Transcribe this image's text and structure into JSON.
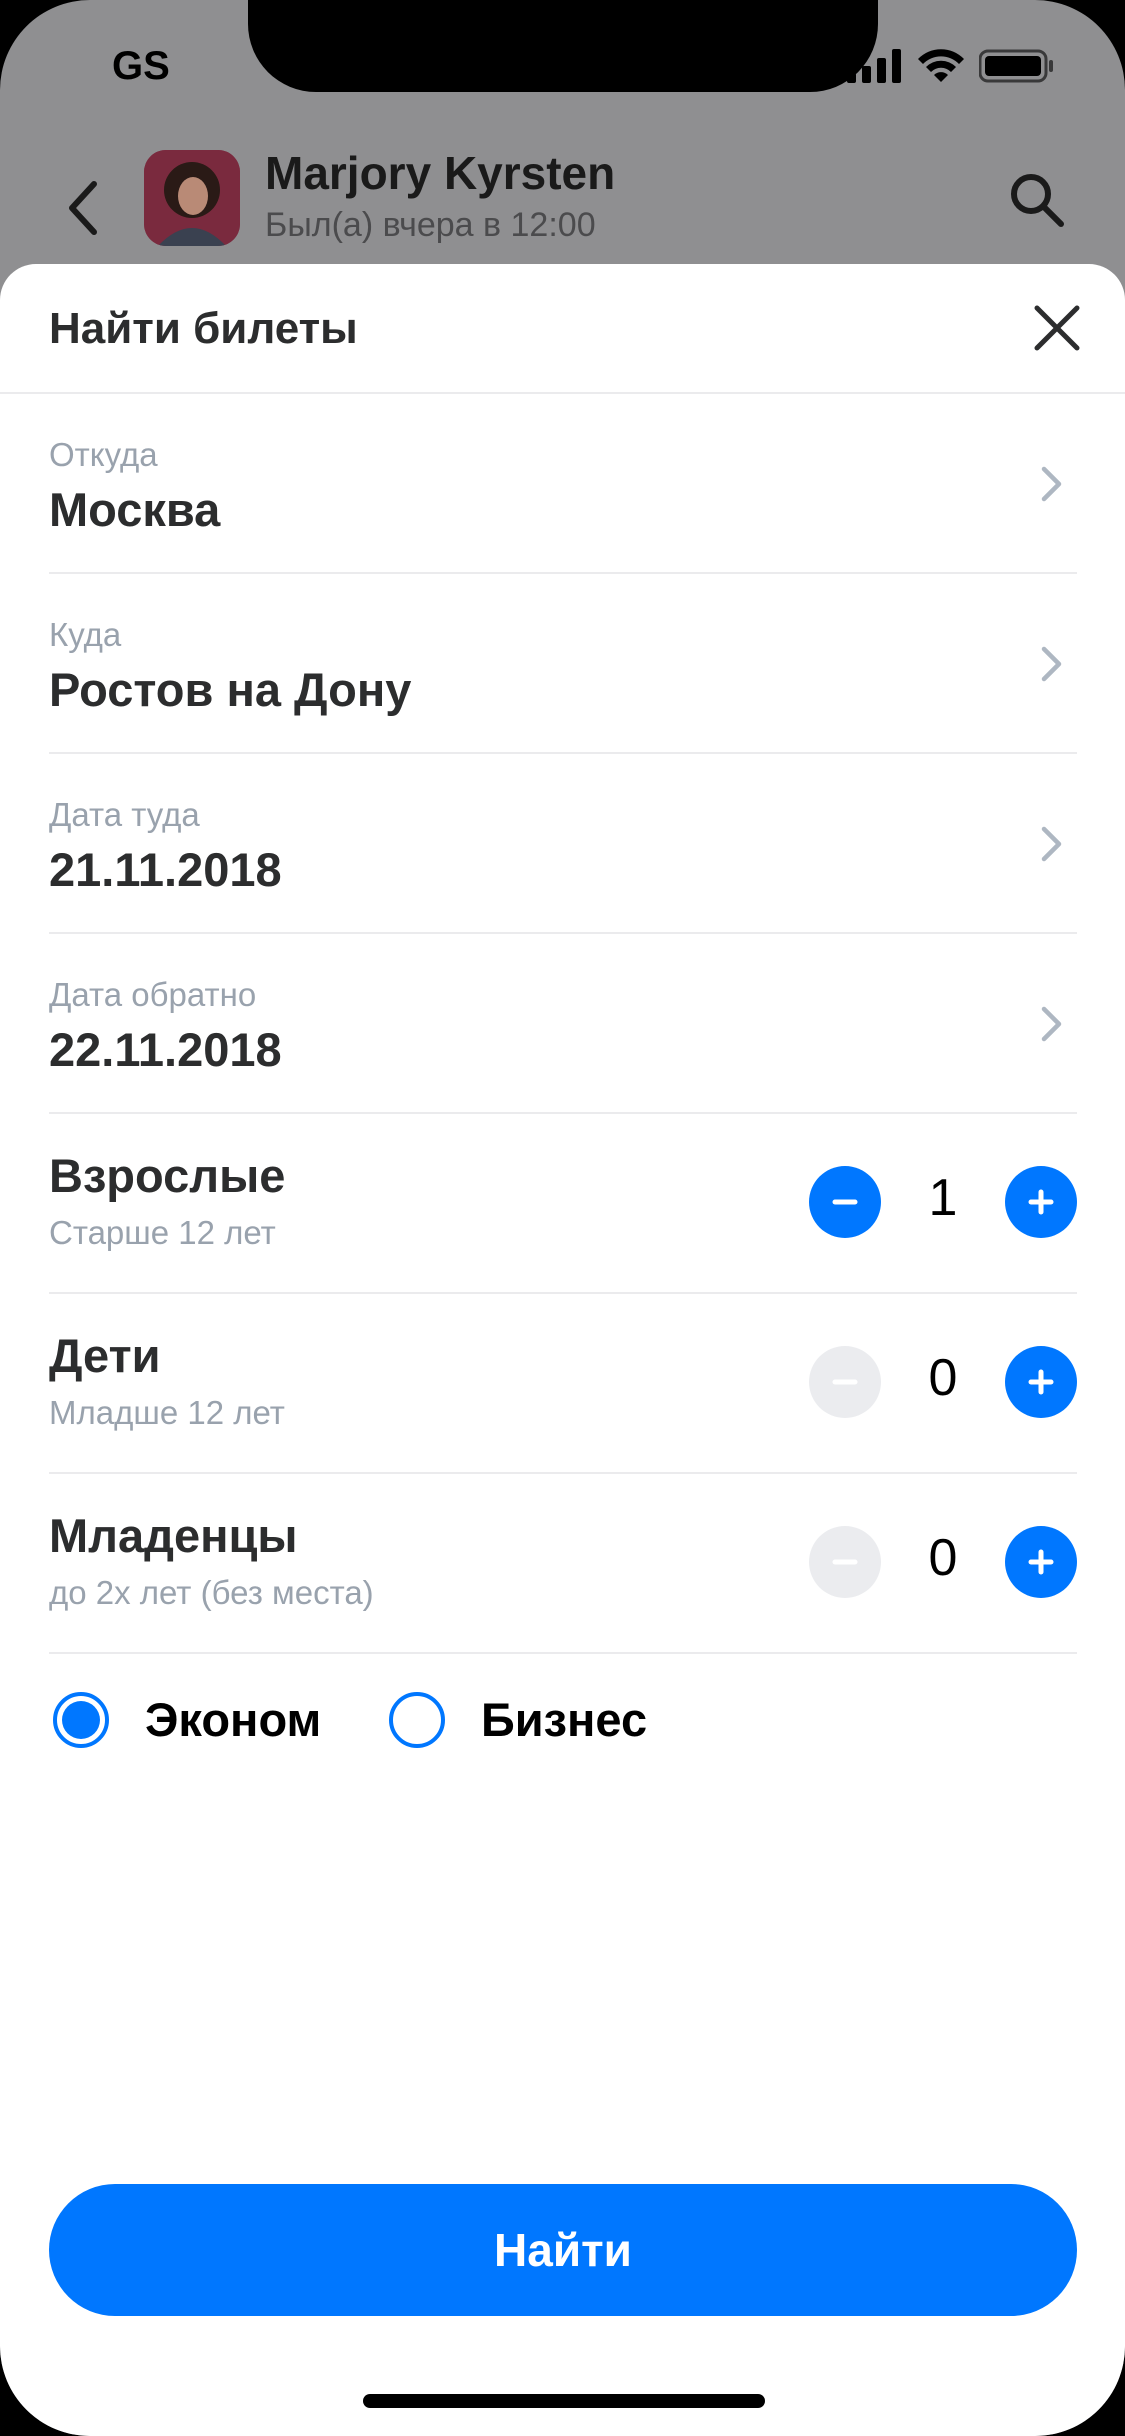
{
  "status_bar": {
    "carrier": "GS"
  },
  "chat": {
    "name": "Marjory Kyrsten",
    "status": "Был(а) вчера в 12:00"
  },
  "sheet": {
    "title": "Найти билеты",
    "fields": [
      {
        "label": "Откуда",
        "value": "Москва"
      },
      {
        "label": "Куда",
        "value": "Ростов на Дону"
      },
      {
        "label": "Дата туда",
        "value": "21.11.2018"
      },
      {
        "label": "Дата обратно",
        "value": "22.11.2018"
      }
    ],
    "passengers": [
      {
        "title": "Взрослые",
        "subtitle": "Старше 12 лет",
        "count": "1",
        "minus_enabled": true
      },
      {
        "title": "Дети",
        "subtitle": "Младше 12 лет",
        "count": "0",
        "minus_enabled": false
      },
      {
        "title": "Младенцы",
        "subtitle": "до 2х лет (без места)",
        "count": "0",
        "minus_enabled": false
      }
    ],
    "classes": [
      {
        "label": "Эконом",
        "selected": true
      },
      {
        "label": "Бизнес",
        "selected": false
      }
    ],
    "submit_label": "Найти"
  },
  "colors": {
    "accent": "#0077ff",
    "text": "#2c2d2e",
    "secondary": "#99a2ad",
    "disabled": "#ebecef"
  }
}
